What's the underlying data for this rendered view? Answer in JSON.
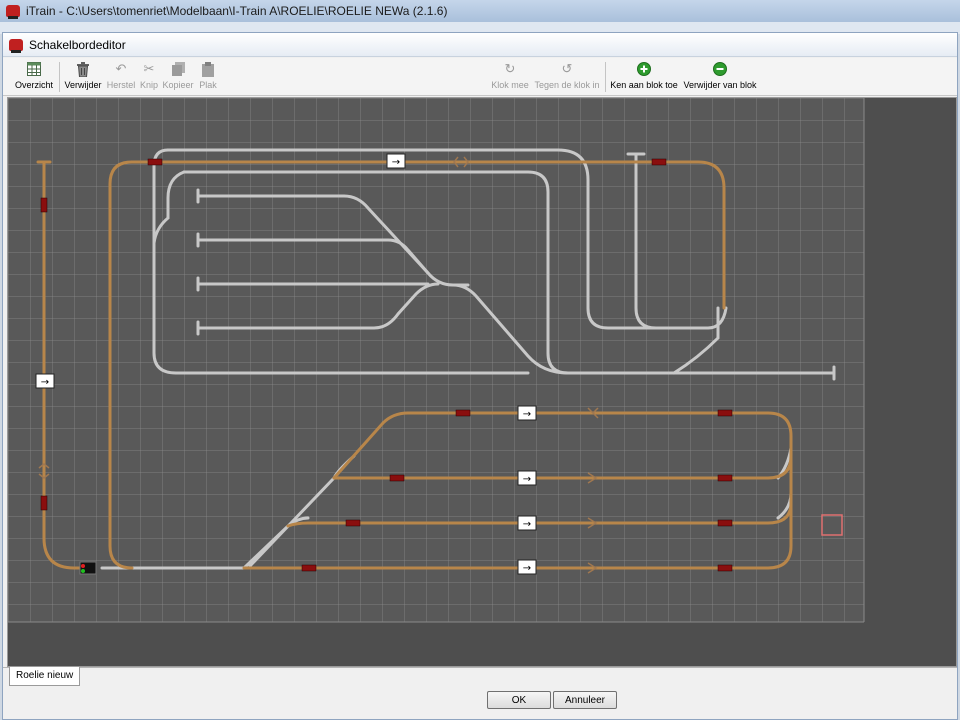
{
  "app": {
    "title": "iTrain - C:\\Users\\tomenriet\\Modelbaan\\I-Train A\\ROELIE\\ROELIE NEWa (2.1.6)"
  },
  "dialog": {
    "title": "Schakelbordeditor"
  },
  "toolbar": {
    "overview": "Overzicht",
    "delete": "Verwijder",
    "restore": "Herstel",
    "cut": "Knip",
    "copy": "Kopieer",
    "paste": "Plak",
    "rotate_cw": "Klok mee",
    "rotate_ccw": "Tegen de klok in",
    "block_assign": "Ken aan blok toe",
    "block_remove": "Verwijder van blok"
  },
  "tabs": [
    {
      "label": "Roelie nieuw"
    }
  ],
  "buttons": {
    "ok": "OK",
    "cancel": "Annuleer"
  },
  "colors": {
    "canvas_bg": "#4e4e4e",
    "grid": "#8a8a8a",
    "track_grey": "#c8c8c8",
    "track_brown": "#b8864a",
    "block_red": "#8a0e0e",
    "add_green": "#2e9b2e",
    "selection_outline": "#e07070"
  },
  "icons": {
    "overview": "table-icon",
    "delete": "trash-icon",
    "restore": "undo-icon",
    "cut": "scissors-icon",
    "copy": "copy-icon",
    "paste": "paste-icon",
    "rotate_cw": "rotate-cw-icon",
    "rotate_ccw": "rotate-ccw-icon",
    "block_assign": "plus-circle-icon",
    "block_remove": "minus-circle-icon"
  }
}
